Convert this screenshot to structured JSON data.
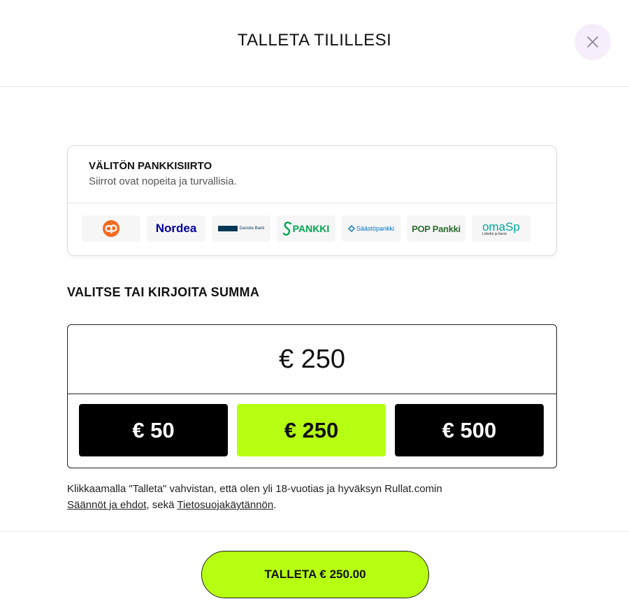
{
  "header": {
    "title": "TALLETA TILILLESI",
    "close_icon": "close-icon"
  },
  "bank_transfer": {
    "title": "VÄLITÖN PANKKISIIRTO",
    "subtitle": "Siirrot ovat nopeita ja turvallisia.",
    "banks": [
      {
        "name": "op-logo",
        "label": "",
        "color": "#f26a21"
      },
      {
        "name": "nordea-logo",
        "label": "Nordea",
        "color": "#0000a0"
      },
      {
        "name": "danske-bank-logo",
        "label": "Danske Bank",
        "color": "#003755"
      },
      {
        "name": "s-pankki-logo",
        "label": "PANKKI",
        "color": "#00a651"
      },
      {
        "name": "saastopankki-logo",
        "label": "Säästöpankki",
        "color": "#0077c8"
      },
      {
        "name": "pop-pankki-logo",
        "label": "POP Pankki",
        "color": "#2c6e2f"
      },
      {
        "name": "omasp-logo",
        "label": "omaSp",
        "sub_label": "Lähellä ja läsnä",
        "color": "#00a69c"
      }
    ]
  },
  "amount": {
    "label": "VALITSE TAI KIRJOITA SUMMA",
    "value": "€ 250",
    "presets": [
      {
        "label": "€ 50",
        "selected": false
      },
      {
        "label": "€ 250",
        "selected": true
      },
      {
        "label": "€ 500",
        "selected": false
      }
    ]
  },
  "terms": {
    "text_before": "Klikkaamalla \"Talleta\" vahvistan, että olen yli 18-vuotias ja hyväksyn Rullat.comin",
    "link_rules": "Säännöt ja ehdot",
    "text_middle": ", sekä ",
    "link_privacy": "Tietosuojakäytännön",
    "text_after": "."
  },
  "deposit_button": {
    "label": "TALLETA € 250.00"
  },
  "colors": {
    "accent": "#b6ff12",
    "dark": "#000000",
    "close_bg": "#f6eefb"
  }
}
